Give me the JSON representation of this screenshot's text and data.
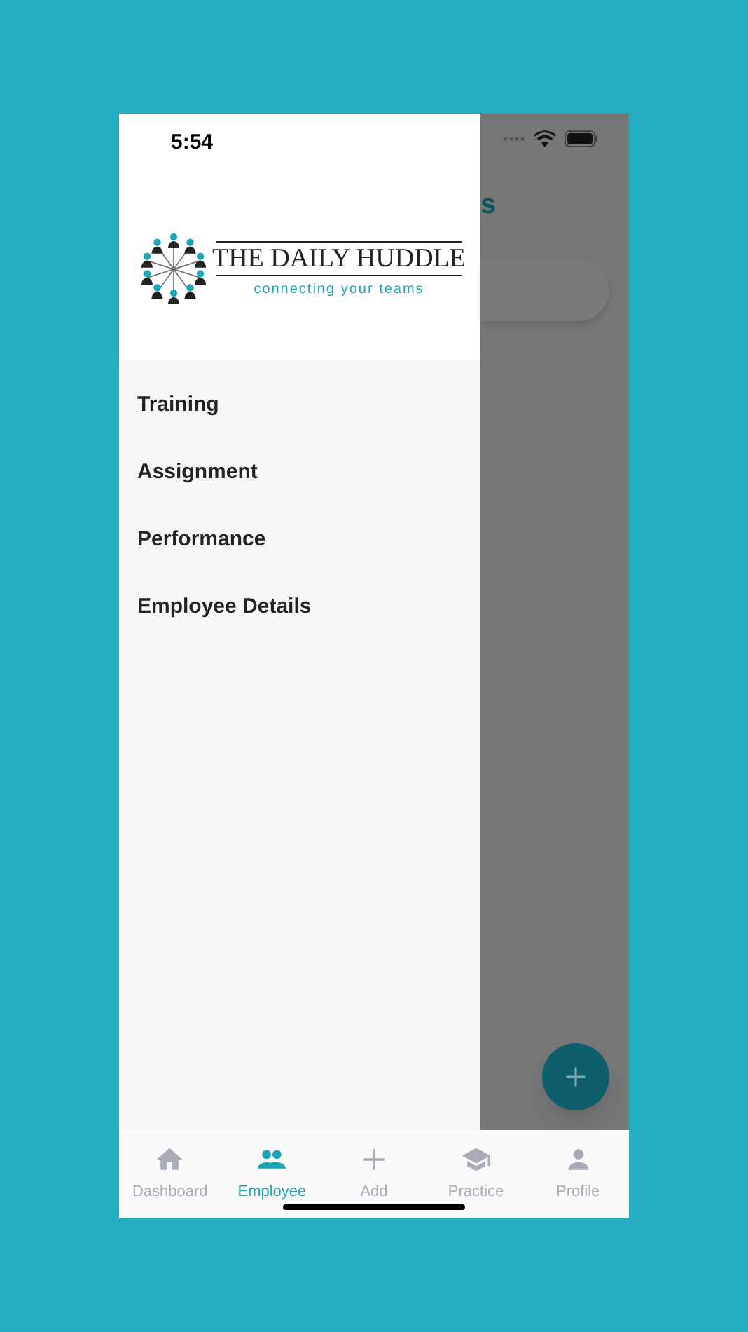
{
  "status_bar": {
    "time": "5:54"
  },
  "background_screen": {
    "title_fragment": "s"
  },
  "drawer": {
    "logo": {
      "title": "THE DAILY HUDDLE",
      "tagline": "connecting your teams"
    },
    "items": [
      {
        "label": "Training"
      },
      {
        "label": "Assignment"
      },
      {
        "label": "Performance"
      },
      {
        "label": "Employee Details"
      }
    ]
  },
  "tab_bar": [
    {
      "label": "Dashboard",
      "kind": "home",
      "selected": false
    },
    {
      "label": "Employee",
      "kind": "people",
      "selected": true
    },
    {
      "label": "Add",
      "kind": "plus",
      "selected": false
    },
    {
      "label": "Practice",
      "kind": "cap",
      "selected": false
    },
    {
      "label": "Profile",
      "kind": "person",
      "selected": false
    }
  ]
}
